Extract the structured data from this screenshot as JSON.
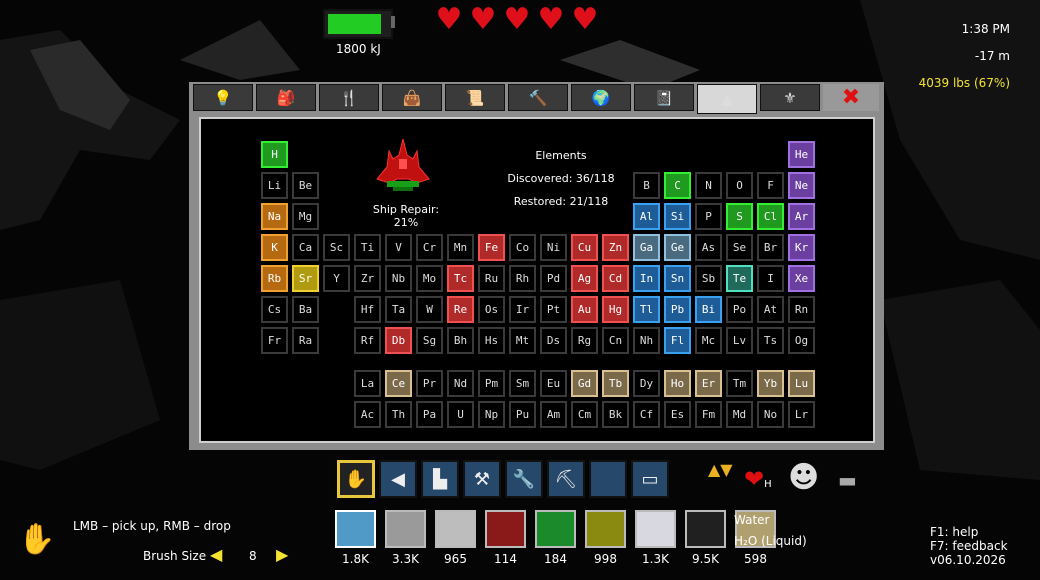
{
  "hud": {
    "energy_text": "1800 kJ",
    "energy_fraction": 0.92,
    "hearts": 5,
    "time": "1:38 PM",
    "depth": "-17 m",
    "weight": "4039 lbs (67%)"
  },
  "tabs": [
    {
      "icon": "lightbulb-icon",
      "glyph": "💡"
    },
    {
      "icon": "backpack-icon",
      "glyph": "🎒"
    },
    {
      "icon": "fork-knife-icon",
      "glyph": "🍴"
    },
    {
      "icon": "red-bag-icon",
      "glyph": "👜"
    },
    {
      "icon": "scroll-icon",
      "glyph": "📜"
    },
    {
      "icon": "hammer-icon",
      "glyph": "🔨"
    },
    {
      "icon": "globe-icon",
      "glyph": "🌍"
    },
    {
      "icon": "notebook-icon",
      "glyph": "📓"
    },
    {
      "icon": "ship-tab-icon",
      "glyph": "▲",
      "active": true
    },
    {
      "icon": "badge-icon",
      "glyph": "⚜"
    }
  ],
  "close_glyph": "✖",
  "info": {
    "title": "Elements",
    "discovered": "Discovered: 36/118",
    "restored": "Restored: 21/118",
    "ship_repair": "Ship Repair: 21%"
  },
  "elements": [
    {
      "s": "H",
      "r": 0,
      "c": 0,
      "st": "g"
    },
    {
      "s": "He",
      "r": 0,
      "c": 17,
      "st": "p"
    },
    {
      "s": "Li",
      "r": 1,
      "c": 0
    },
    {
      "s": "Be",
      "r": 1,
      "c": 1
    },
    {
      "s": "B",
      "r": 1,
      "c": 12
    },
    {
      "s": "C",
      "r": 1,
      "c": 13,
      "st": "g"
    },
    {
      "s": "N",
      "r": 1,
      "c": 14
    },
    {
      "s": "O",
      "r": 1,
      "c": 15
    },
    {
      "s": "F",
      "r": 1,
      "c": 16
    },
    {
      "s": "Ne",
      "r": 1,
      "c": 17,
      "st": "p"
    },
    {
      "s": "Na",
      "r": 2,
      "c": 0,
      "st": "o"
    },
    {
      "s": "Mg",
      "r": 2,
      "c": 1
    },
    {
      "s": "Al",
      "r": 2,
      "c": 12,
      "st": "b"
    },
    {
      "s": "Si",
      "r": 2,
      "c": 13,
      "st": "b"
    },
    {
      "s": "P",
      "r": 2,
      "c": 14
    },
    {
      "s": "S",
      "r": 2,
      "c": 15,
      "st": "g"
    },
    {
      "s": "Cl",
      "r": 2,
      "c": 16,
      "st": "g"
    },
    {
      "s": "Ar",
      "r": 2,
      "c": 17,
      "st": "p"
    },
    {
      "s": "K",
      "r": 3,
      "c": 0,
      "st": "o"
    },
    {
      "s": "Ca",
      "r": 3,
      "c": 1
    },
    {
      "s": "Sc",
      "r": 3,
      "c": 2
    },
    {
      "s": "Ti",
      "r": 3,
      "c": 3
    },
    {
      "s": "V",
      "r": 3,
      "c": 4
    },
    {
      "s": "Cr",
      "r": 3,
      "c": 5
    },
    {
      "s": "Mn",
      "r": 3,
      "c": 6
    },
    {
      "s": "Fe",
      "r": 3,
      "c": 7,
      "st": "r"
    },
    {
      "s": "Co",
      "r": 3,
      "c": 8
    },
    {
      "s": "Ni",
      "r": 3,
      "c": 9
    },
    {
      "s": "Cu",
      "r": 3,
      "c": 10,
      "st": "r"
    },
    {
      "s": "Zn",
      "r": 3,
      "c": 11,
      "st": "r"
    },
    {
      "s": "Ga",
      "r": 3,
      "c": 12,
      "st": "lb"
    },
    {
      "s": "Ge",
      "r": 3,
      "c": 13,
      "st": "lb"
    },
    {
      "s": "As",
      "r": 3,
      "c": 14
    },
    {
      "s": "Se",
      "r": 3,
      "c": 15
    },
    {
      "s": "Br",
      "r": 3,
      "c": 16
    },
    {
      "s": "Kr",
      "r": 3,
      "c": 17,
      "st": "p"
    },
    {
      "s": "Rb",
      "r": 4,
      "c": 0,
      "st": "o"
    },
    {
      "s": "Sr",
      "r": 4,
      "c": 1,
      "st": "y"
    },
    {
      "s": "Y",
      "r": 4,
      "c": 2
    },
    {
      "s": "Zr",
      "r": 4,
      "c": 3
    },
    {
      "s": "Nb",
      "r": 4,
      "c": 4
    },
    {
      "s": "Mo",
      "r": 4,
      "c": 5
    },
    {
      "s": "Tc",
      "r": 4,
      "c": 6,
      "st": "r"
    },
    {
      "s": "Ru",
      "r": 4,
      "c": 7
    },
    {
      "s": "Rh",
      "r": 4,
      "c": 8
    },
    {
      "s": "Pd",
      "r": 4,
      "c": 9
    },
    {
      "s": "Ag",
      "r": 4,
      "c": 10,
      "st": "r"
    },
    {
      "s": "Cd",
      "r": 4,
      "c": 11,
      "st": "r"
    },
    {
      "s": "In",
      "r": 4,
      "c": 12,
      "st": "b"
    },
    {
      "s": "Sn",
      "r": 4,
      "c": 13,
      "st": "b"
    },
    {
      "s": "Sb",
      "r": 4,
      "c": 14
    },
    {
      "s": "Te",
      "r": 4,
      "c": 15,
      "st": "t"
    },
    {
      "s": "I",
      "r": 4,
      "c": 16
    },
    {
      "s": "Xe",
      "r": 4,
      "c": 17,
      "st": "p"
    },
    {
      "s": "Cs",
      "r": 5,
      "c": 0
    },
    {
      "s": "Ba",
      "r": 5,
      "c": 1
    },
    {
      "s": "Hf",
      "r": 5,
      "c": 3
    },
    {
      "s": "Ta",
      "r": 5,
      "c": 4
    },
    {
      "s": "W",
      "r": 5,
      "c": 5
    },
    {
      "s": "Re",
      "r": 5,
      "c": 6,
      "st": "r"
    },
    {
      "s": "Os",
      "r": 5,
      "c": 7
    },
    {
      "s": "Ir",
      "r": 5,
      "c": 8
    },
    {
      "s": "Pt",
      "r": 5,
      "c": 9
    },
    {
      "s": "Au",
      "r": 5,
      "c": 10,
      "st": "r"
    },
    {
      "s": "Hg",
      "r": 5,
      "c": 11,
      "st": "r"
    },
    {
      "s": "Tl",
      "r": 5,
      "c": 12,
      "st": "b"
    },
    {
      "s": "Pb",
      "r": 5,
      "c": 13,
      "st": "b"
    },
    {
      "s": "Bi",
      "r": 5,
      "c": 14,
      "st": "b"
    },
    {
      "s": "Po",
      "r": 5,
      "c": 15
    },
    {
      "s": "At",
      "r": 5,
      "c": 16
    },
    {
      "s": "Rn",
      "r": 5,
      "c": 17
    },
    {
      "s": "Fr",
      "r": 6,
      "c": 0
    },
    {
      "s": "Ra",
      "r": 6,
      "c": 1
    },
    {
      "s": "Rf",
      "r": 6,
      "c": 3
    },
    {
      "s": "Db",
      "r": 6,
      "c": 4,
      "st": "r"
    },
    {
      "s": "Sg",
      "r": 6,
      "c": 5
    },
    {
      "s": "Bh",
      "r": 6,
      "c": 6
    },
    {
      "s": "Hs",
      "r": 6,
      "c": 7
    },
    {
      "s": "Mt",
      "r": 6,
      "c": 8
    },
    {
      "s": "Ds",
      "r": 6,
      "c": 9
    },
    {
      "s": "Rg",
      "r": 6,
      "c": 10
    },
    {
      "s": "Cn",
      "r": 6,
      "c": 11
    },
    {
      "s": "Nh",
      "r": 6,
      "c": 12
    },
    {
      "s": "Fl",
      "r": 6,
      "c": 13,
      "st": "b"
    },
    {
      "s": "Mc",
      "r": 6,
      "c": 14
    },
    {
      "s": "Lv",
      "r": 6,
      "c": 15
    },
    {
      "s": "Ts",
      "r": 6,
      "c": 16
    },
    {
      "s": "Og",
      "r": 6,
      "c": 17
    },
    {
      "s": "La",
      "r": 8,
      "c": 3
    },
    {
      "s": "Ce",
      "r": 8,
      "c": 4,
      "st": "k"
    },
    {
      "s": "Pr",
      "r": 8,
      "c": 5
    },
    {
      "s": "Nd",
      "r": 8,
      "c": 6
    },
    {
      "s": "Pm",
      "r": 8,
      "c": 7
    },
    {
      "s": "Sm",
      "r": 8,
      "c": 8
    },
    {
      "s": "Eu",
      "r": 8,
      "c": 9
    },
    {
      "s": "Gd",
      "r": 8,
      "c": 10,
      "st": "k"
    },
    {
      "s": "Tb",
      "r": 8,
      "c": 11,
      "st": "k"
    },
    {
      "s": "Dy",
      "r": 8,
      "c": 12
    },
    {
      "s": "Ho",
      "r": 8,
      "c": 13,
      "st": "k"
    },
    {
      "s": "Er",
      "r": 8,
      "c": 14,
      "st": "k"
    },
    {
      "s": "Tm",
      "r": 8,
      "c": 15
    },
    {
      "s": "Yb",
      "r": 8,
      "c": 16,
      "st": "k"
    },
    {
      "s": "Lu",
      "r": 8,
      "c": 17,
      "st": "k"
    },
    {
      "s": "Ac",
      "r": 9,
      "c": 3
    },
    {
      "s": "Th",
      "r": 9,
      "c": 4
    },
    {
      "s": "Pa",
      "r": 9,
      "c": 5
    },
    {
      "s": "U",
      "r": 9,
      "c": 6
    },
    {
      "s": "Np",
      "r": 9,
      "c": 7
    },
    {
      "s": "Pu",
      "r": 9,
      "c": 8
    },
    {
      "s": "Am",
      "r": 9,
      "c": 9
    },
    {
      "s": "Cm",
      "r": 9,
      "c": 10
    },
    {
      "s": "Bk",
      "r": 9,
      "c": 11
    },
    {
      "s": "Cf",
      "r": 9,
      "c": 12
    },
    {
      "s": "Es",
      "r": 9,
      "c": 13
    },
    {
      "s": "Fm",
      "r": 9,
      "c": 14
    },
    {
      "s": "Md",
      "r": 9,
      "c": 15
    },
    {
      "s": "No",
      "r": 9,
      "c": 16
    },
    {
      "s": "Lr",
      "r": 9,
      "c": 17
    }
  ],
  "element_styles": {
    "g": {
      "bg": "#1f9a1f",
      "border": "#33ee33"
    },
    "p": {
      "bg": "#6a3fa0",
      "border": "#a070e0"
    },
    "o": {
      "bg": "#b56a12",
      "border": "#f0a030"
    },
    "y": {
      "bg": "#b09a10",
      "border": "#f0d030"
    },
    "r": {
      "bg": "#b02a2a",
      "border": "#f05050"
    },
    "b": {
      "bg": "#1d5c96",
      "border": "#3aa0f0"
    },
    "lb": {
      "bg": "#4a6a80",
      "border": "#90c0e0"
    },
    "t": {
      "bg": "#1f6a5a",
      "border": "#50e0c0"
    },
    "k": {
      "bg": "#7a6a4a",
      "border": "#d8c090"
    }
  },
  "tools": [
    {
      "icon": "hand-icon",
      "glyph": "✋",
      "active": true
    },
    {
      "icon": "drill-icon",
      "glyph": "◀"
    },
    {
      "icon": "boot-icon",
      "glyph": "▙"
    },
    {
      "icon": "hammer-tool-icon",
      "glyph": "⚒"
    },
    {
      "icon": "wrench-icon",
      "glyph": "🔧"
    },
    {
      "icon": "pick-icon",
      "glyph": "⛏"
    },
    {
      "icon": "empty-slot-icon",
      "glyph": ""
    },
    {
      "icon": "gun-icon",
      "glyph": "▭"
    }
  ],
  "swap_glyphs": "▲▼",
  "extras": [
    "❤",
    "☻",
    "▬"
  ],
  "extra_label": "H",
  "materials": [
    {
      "color": "#4f9ac6",
      "count": "1.8K"
    },
    {
      "color": "#9a9a9a",
      "count": "3.3K"
    },
    {
      "color": "#bdbdbd",
      "count": "965"
    },
    {
      "color": "#8a1a1a",
      "count": "114"
    },
    {
      "color": "#1a8a2a",
      "count": "184"
    },
    {
      "color": "#8a8a10",
      "count": "998"
    },
    {
      "color": "#d8d8e0",
      "count": "1.3K"
    },
    {
      "color": "#202020",
      "count": "9.5K"
    },
    {
      "color": "#b0a070",
      "count": "598"
    }
  ],
  "material_name": "Water",
  "material_state": "H₂O (Liquid)",
  "hint": "LMB – pick up, RMB – drop",
  "brush": {
    "label": "Brush Size",
    "value": "8",
    "dec": "◀",
    "inc": "▶"
  },
  "help": {
    "line1": "F1: help",
    "line2": "F7: feedback",
    "version": "v06.10.2026"
  }
}
